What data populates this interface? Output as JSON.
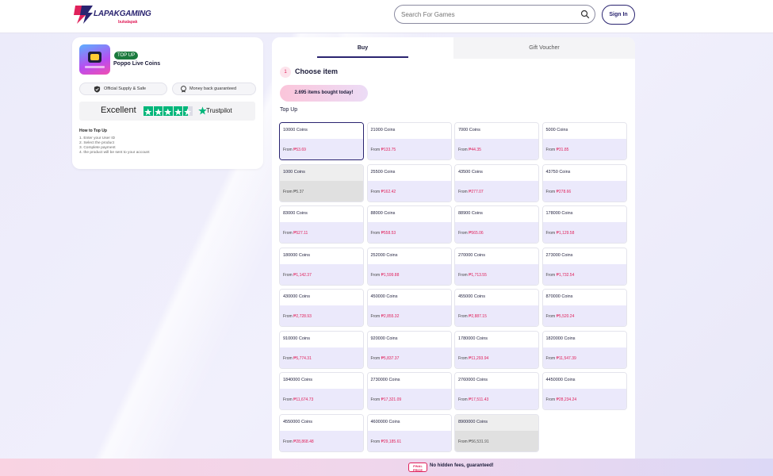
{
  "header": {
    "logo_text": "LAPAKGAMING",
    "logo_sub": "bukalapak",
    "search_placeholder": "Search For Games",
    "signin_label": "Sign In"
  },
  "product": {
    "badge": "TOP UP",
    "name": "Poppo Live Coins",
    "pills": [
      "Official Supply & Safe",
      "Money back guaranteed"
    ],
    "trustpilot_rating_label": "Excellent",
    "trustpilot_brand": "Trustpilot",
    "trustpilot_stars": 4.5,
    "howto_title": "How to Top Up",
    "howto_steps": [
      "1. Enter your User ID",
      "2. Select the product",
      "3. Complete payment",
      "4. the product will be sent to your account"
    ]
  },
  "tabs": {
    "buy": "Buy",
    "gift": "Gift Voucher"
  },
  "choose": {
    "step": "1",
    "title": "Choose item",
    "bought_today": "2.695 items bought today!",
    "section": "Top Up",
    "from_label": "From",
    "items": [
      {
        "name": "10000 Coins",
        "price": "₱53.69",
        "state": "selected"
      },
      {
        "name": "21000 Coins",
        "price": "₱133.75",
        "state": "normal"
      },
      {
        "name": "7000 Coins",
        "price": "₱44.35",
        "state": "normal"
      },
      {
        "name": "5000 Coins",
        "price": "₱31.85",
        "state": "normal"
      },
      {
        "name": "1000 Coins",
        "price": "₱5.37",
        "state": "disabled"
      },
      {
        "name": "25500 Coins",
        "price": "₱162.42",
        "state": "normal"
      },
      {
        "name": "43500 Coins",
        "price": "₱277.07",
        "state": "normal"
      },
      {
        "name": "43750 Coins",
        "price": "₱278.66",
        "state": "normal"
      },
      {
        "name": "83000 Coins",
        "price": "₱527.11",
        "state": "normal"
      },
      {
        "name": "88000 Coins",
        "price": "₱558.53",
        "state": "normal"
      },
      {
        "name": "88900 Coins",
        "price": "₱565.06",
        "state": "normal"
      },
      {
        "name": "178000 Coins",
        "price": "₱1,129.58",
        "state": "normal"
      },
      {
        "name": "180000 Coins",
        "price": "₱1,142.37",
        "state": "normal"
      },
      {
        "name": "252000 Coins",
        "price": "₱1,599.88",
        "state": "normal"
      },
      {
        "name": "270000 Coins",
        "price": "₱1,713.55",
        "state": "normal"
      },
      {
        "name": "273000 Coins",
        "price": "₱1,732.54",
        "state": "normal"
      },
      {
        "name": "430000 Coins",
        "price": "₱2,728.93",
        "state": "normal"
      },
      {
        "name": "450000 Coins",
        "price": "₱2,855.32",
        "state": "normal"
      },
      {
        "name": "455000 Coins",
        "price": "₱2,887.15",
        "state": "normal"
      },
      {
        "name": "870000 Coins",
        "price": "₱5,520.24",
        "state": "normal"
      },
      {
        "name": "910000 Coins",
        "price": "₱5,774.31",
        "state": "normal"
      },
      {
        "name": "920000 Coins",
        "price": "₱5,837.37",
        "state": "normal"
      },
      {
        "name": "1780000 Coins",
        "price": "₱11,293.94",
        "state": "normal"
      },
      {
        "name": "1820000 Coins",
        "price": "₱11,547.39",
        "state": "normal"
      },
      {
        "name": "1840000 Coins",
        "price": "₱11,674.73",
        "state": "normal"
      },
      {
        "name": "2730000 Coins",
        "price": "₱17,321.09",
        "state": "normal"
      },
      {
        "name": "2760000 Coins",
        "price": "₱17,511.43",
        "state": "normal"
      },
      {
        "name": "4450000 Coins",
        "price": "₱28,234.24",
        "state": "normal"
      },
      {
        "name": "4550000 Coins",
        "price": "₱28,868.48",
        "state": "normal"
      },
      {
        "name": "4600000 Coins",
        "price": "₱29,185.61",
        "state": "normal"
      },
      {
        "name": "8900000 Coins",
        "price": "₱56,531.91",
        "state": "disabled"
      }
    ]
  },
  "footer": {
    "badge": "FINAL PRICE",
    "text": "No hidden fees, guaranteed!"
  },
  "colors": {
    "brand_navy": "#2a2470",
    "accent_pink": "#e0215b",
    "trustpilot_green": "#00b67a",
    "topup_green": "#1b7a3e"
  }
}
